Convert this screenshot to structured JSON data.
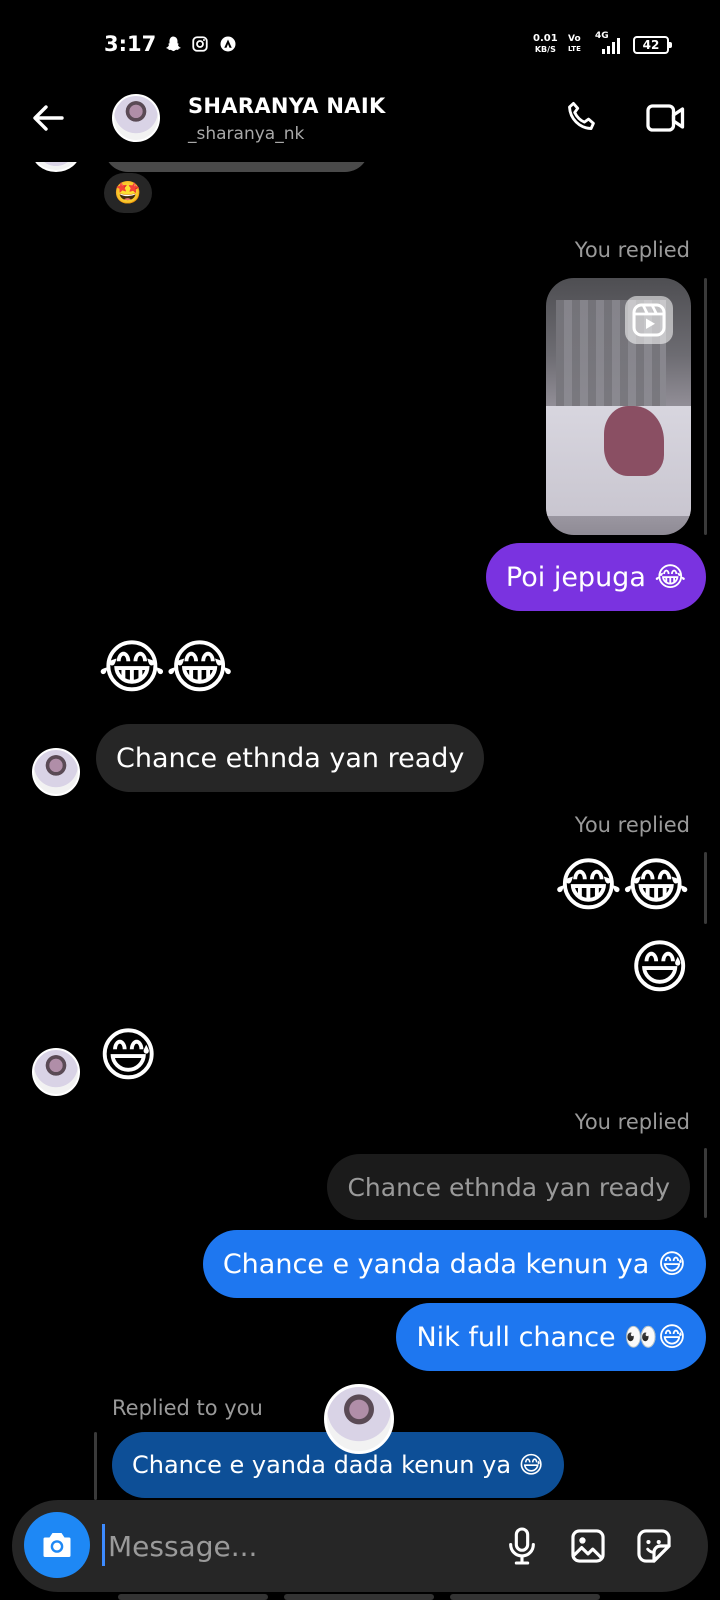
{
  "status_bar": {
    "time": "3:17",
    "net_speed_value": "0.01",
    "net_speed_unit": "KB/S",
    "volte_top": "Vo",
    "volte_bottom": "LTE",
    "network": "4G",
    "battery": "42",
    "icons": [
      "snapchat-icon",
      "instagram-icon",
      "app-icon"
    ]
  },
  "header": {
    "name": "SHARANYA NAIK",
    "handle": "_sharanya_nk",
    "icons": [
      "back-arrow-icon",
      "phone-icon",
      "video-camera-icon"
    ]
  },
  "messages": {
    "reaction_emoji": "🤩",
    "reply_label_1": "You replied",
    "reel_icon": "reels-icon",
    "msg_poi": "Poi jepuga 😂",
    "emoji_laugh_1": "😂😂",
    "msg_chance_in": "Chance ethnda yan ready",
    "reply_label_2": "You replied",
    "emoji_laugh_2": "😂😂",
    "emoji_sweat_out": "😅",
    "emoji_sweat_in": "😅",
    "reply_label_3": "You replied",
    "quoted_text": "Chance ethnda yan ready",
    "msg_chance_out": "Chance e yanda dada kenun ya 😅",
    "msg_nik": "Nik full chance 👀😅",
    "replied_to_you": "Replied to you",
    "msg_reply_in": "Chance e yanda dada kenun ya 😅"
  },
  "composer": {
    "placeholder": "Message...",
    "icons": [
      "camera-icon",
      "microphone-icon",
      "gallery-icon",
      "sticker-icon"
    ]
  },
  "colors": {
    "background": "#000000",
    "incoming_bubble": "#262626",
    "purple_bubble": "#7a33e0",
    "blue_bubble": "#1e77f0",
    "camera_button": "#1e88f5"
  }
}
